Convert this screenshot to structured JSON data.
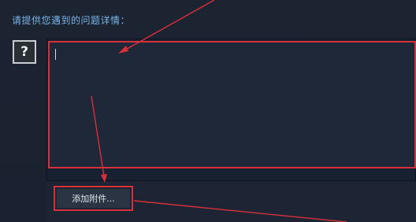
{
  "form": {
    "prompt_label": "请提供您遇到的问题详情：",
    "details_value": "",
    "help_icon_glyph": "?",
    "attach_button_label": "添加附件..."
  },
  "colors": {
    "background": "#1b2230",
    "label": "#7ab5e6",
    "annotation_red": "#d8303a"
  },
  "icons": {
    "help": "question-mark-icon"
  }
}
